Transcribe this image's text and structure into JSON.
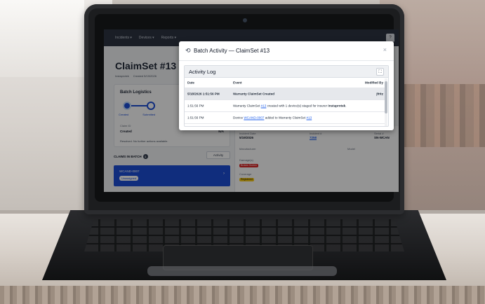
{
  "topbar": {
    "items": [
      "Incidents ▾",
      "Devices ▾",
      "Reports ▾"
    ],
    "right_icon": "?"
  },
  "page": {
    "title": "ClaimSet #13",
    "meta_insurer": "Instaprotek",
    "meta_created": "Created 5/19/2026"
  },
  "logistics": {
    "title": "Batch Logistics",
    "steps": [
      "Created",
      "Submitted"
    ],
    "claim_id_label": "Claim ID",
    "status_value": "Created",
    "na_value": "N/A",
    "resolved_text": "Resolved. No further actions available."
  },
  "claims": {
    "label": "CLAIMS IN BATCH",
    "count": "1",
    "activity_button": "Activity",
    "items": [
      {
        "id": "WCAND-0007",
        "status": "Unassigned"
      }
    ]
  },
  "detail": {
    "incident_date_label": "Incident Date",
    "incident_date_value": "5/19/2026",
    "incident_num_label": "Incident #",
    "incident_num_value": "7258",
    "serial_label": "Serial #",
    "serial_value": "SN-WCAN",
    "manufacturer_label": "Manufacturer",
    "model_label": "Model",
    "damage_label": "Damage(s)",
    "damage_tag": "Broken Screen",
    "coverage_label": "Coverage",
    "coverage_tag": "Registered"
  },
  "modal": {
    "title": "Batch Activity — ClaimSet #13",
    "close": "×",
    "log_title": "Activity Log",
    "expand": "⛶",
    "columns": {
      "date": "Date",
      "event": "Event",
      "by": "Modified By"
    },
    "rows": [
      {
        "date": "5/18/2026 1:51:56 PM",
        "event": "Warranty ClaimSet Created",
        "by": "jfritz"
      },
      {
        "date": "1:51:56 PM",
        "event_prefix": "Warranty ClaimSet ",
        "event_link": "#13",
        "event_mid": " created with 1 device(s) staged for insurer ",
        "event_bold": "Instaprotek",
        "event_suffix": "."
      },
      {
        "date": "1:51:56 PM",
        "event_prefix": "Device ",
        "event_link": "WCAND-0007",
        "event_mid": " added to Warranty ClaimSet ",
        "event_link2": "#13"
      }
    ]
  },
  "colors": {
    "accent": "#1d4ed8",
    "topbar": "#2e3543",
    "link": "#2563eb"
  }
}
